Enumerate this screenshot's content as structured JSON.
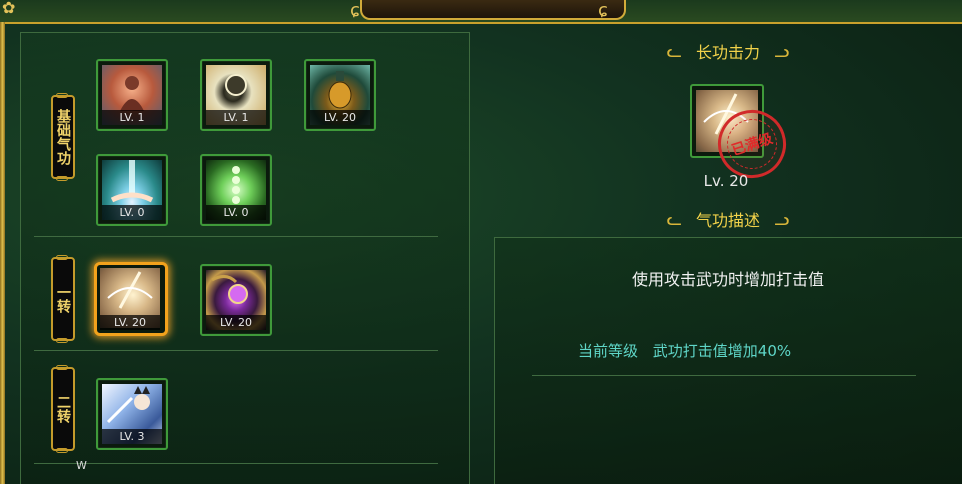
{
  "sections": [
    {
      "label": "基础气功",
      "skills": [
        {
          "level": "LV. 1",
          "icon": "figure-aura-icon"
        },
        {
          "level": "LV. 1",
          "icon": "golden-orb-icon"
        },
        {
          "level": "LV. 20",
          "icon": "potion-bottle-icon"
        },
        {
          "level": "LV. 0",
          "icon": "light-hand-icon"
        },
        {
          "level": "LV. 0",
          "icon": "green-beads-icon"
        }
      ]
    },
    {
      "label": "一转",
      "skills": [
        {
          "level": "LV. 20",
          "icon": "blade-slash-icon",
          "selected": true
        },
        {
          "level": "LV. 20",
          "icon": "purple-orb-claw-icon"
        }
      ]
    },
    {
      "label": "二转",
      "skills": [
        {
          "level": "LV. 3",
          "icon": "archer-portrait-icon"
        }
      ]
    }
  ],
  "detail": {
    "title": "长功击力",
    "level": "Lv. 20",
    "stamp_text": "已满级",
    "desc_title": "气功描述",
    "description": "使用攻击武功时增加打击值",
    "current_label": "当前等级",
    "current_effect": "武功打击值增加40%"
  },
  "misc": {
    "watermark_letter": "W"
  },
  "colors": {
    "gold": "#f2d24a",
    "cyan_text": "#5fd6c8",
    "selected_border": "#f2a21c"
  }
}
